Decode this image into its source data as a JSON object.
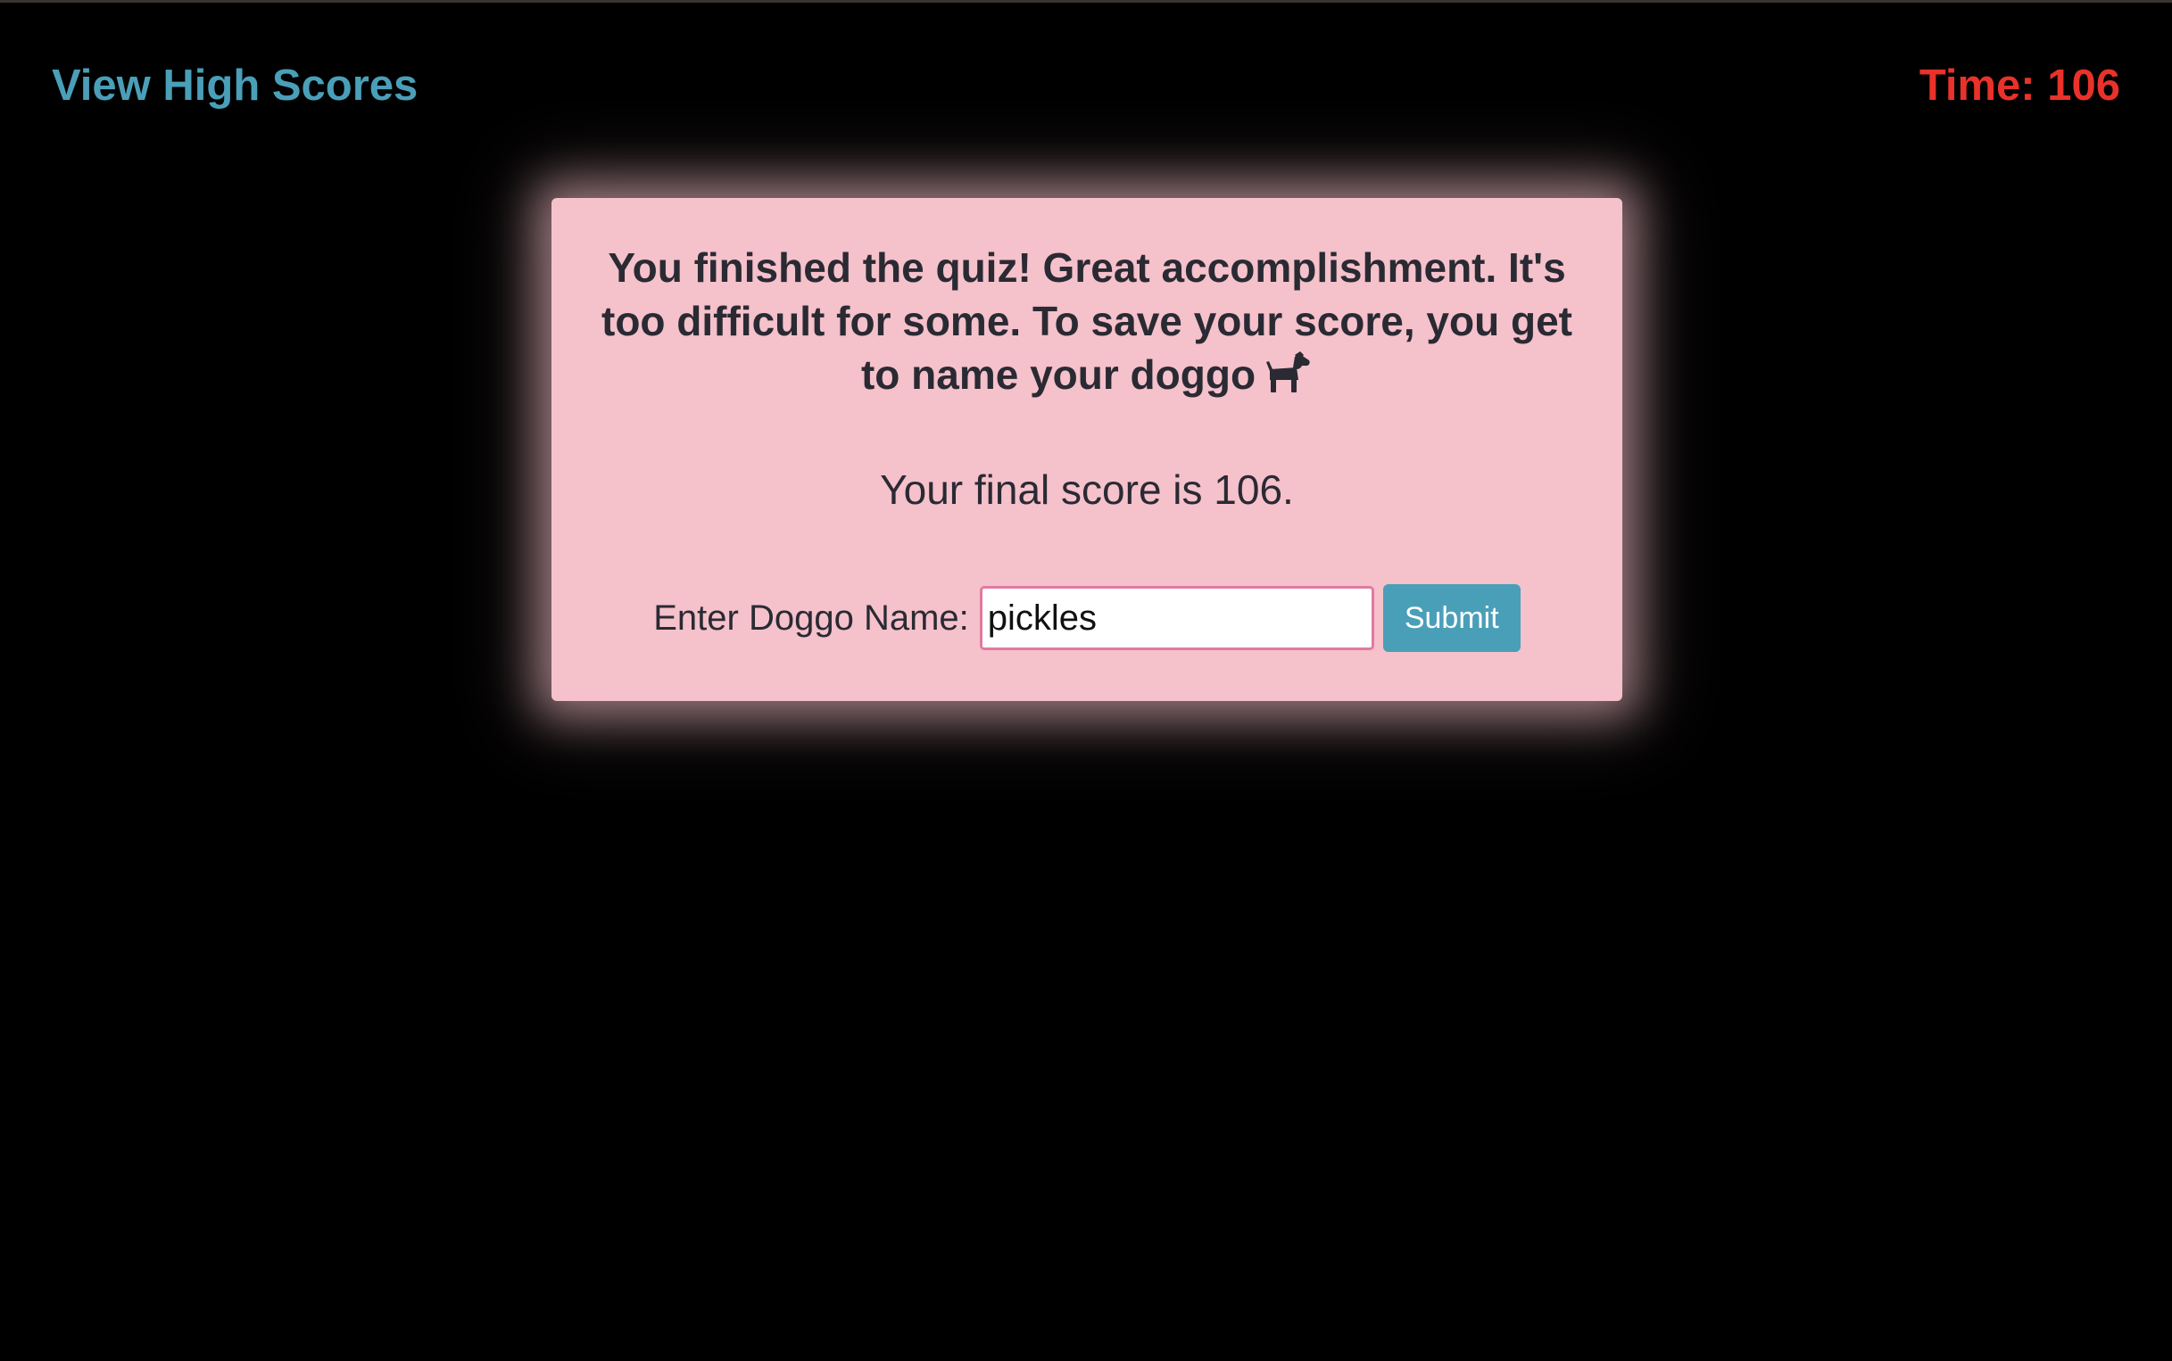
{
  "header": {
    "high_scores_link": "View High Scores",
    "timer_label": "Time: 106"
  },
  "card": {
    "message": "You finished the quiz! Great accomplishment. It's too difficult for some. To save your score, you get to name your doggo",
    "message_icon": "dog-icon",
    "final_score_text": "Your final score is 106.",
    "name_label": "Enter Doggo Name:",
    "name_input_value": "pickles",
    "submit_label": "Submit"
  },
  "colors": {
    "background": "#000000",
    "link": "#4a9fb8",
    "timer": "#e8322a",
    "card": "#f5c1cb",
    "button": "#4a9fb8",
    "input_border": "#e07aa0"
  }
}
